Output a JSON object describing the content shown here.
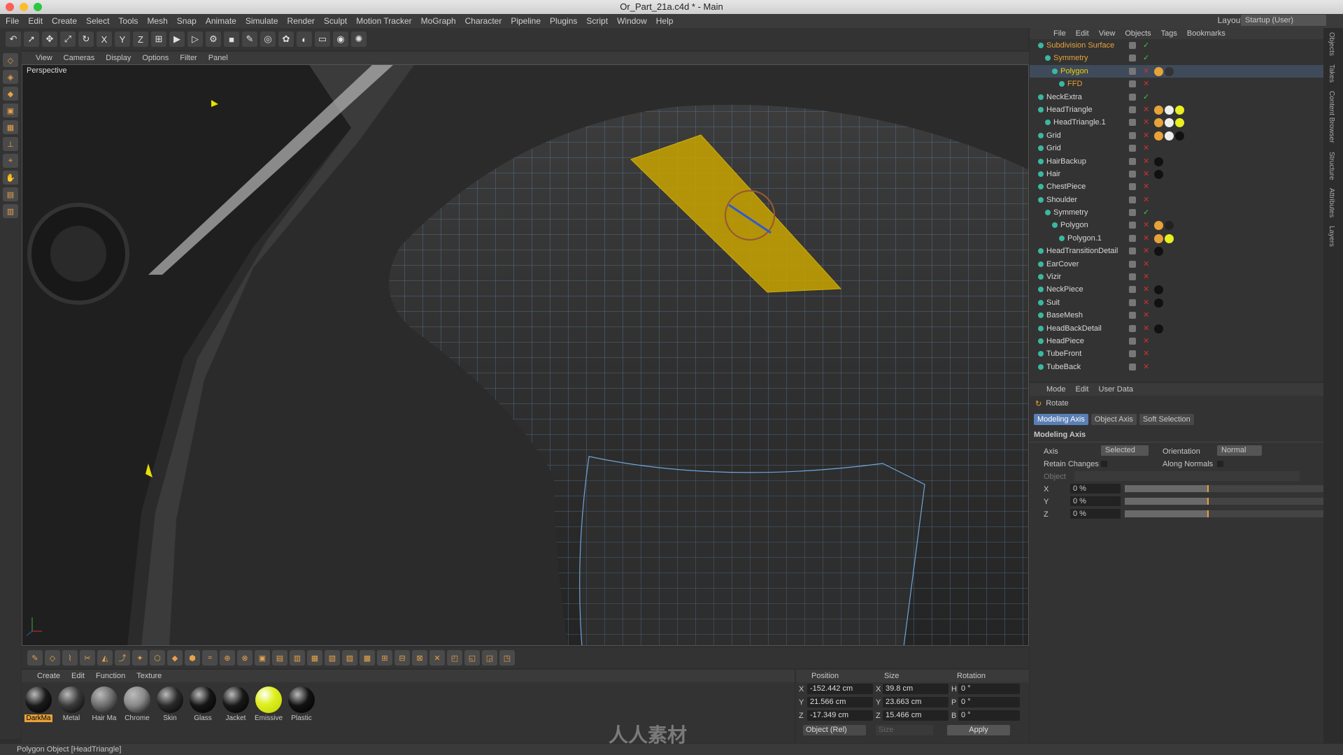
{
  "window": {
    "title": "Or_Part_21a.c4d * - Main"
  },
  "menu": [
    "File",
    "Edit",
    "Create",
    "Select",
    "Tools",
    "Mesh",
    "Snap",
    "Animate",
    "Simulate",
    "Render",
    "Sculpt",
    "Motion Tracker",
    "MoGraph",
    "Character",
    "Pipeline",
    "Plugins",
    "Script",
    "Window",
    "Help"
  ],
  "layout": {
    "label": "Layout:",
    "value": "Startup (User)"
  },
  "toolbar": {
    "icons": [
      "undo-icon",
      "select-icon",
      "move-icon",
      "scale-icon",
      "rotate-icon",
      "x-axis-icon",
      "y-axis-icon",
      "z-axis-icon",
      "coord-icon",
      "render-icon",
      "render-view-icon",
      "render-settings-icon",
      "cube-icon",
      "pen-icon",
      "subdivide-icon",
      "cloner-icon",
      "deformer-icon",
      "floor-icon",
      "camera-icon",
      "light-icon"
    ]
  },
  "viewport": {
    "menu": [
      "View",
      "Cameras",
      "Display",
      "Options",
      "Filter",
      "Panel"
    ],
    "label": "Perspective"
  },
  "objects": {
    "menu": [
      "File",
      "Edit",
      "View",
      "Objects",
      "Tags",
      "Bookmarks"
    ],
    "rows": [
      {
        "name": "Subdivision Surface",
        "indent": 0,
        "color": "#e8a23a",
        "check": "✓"
      },
      {
        "name": "Symmetry",
        "indent": 1,
        "color": "#e8a23a",
        "check": "✓"
      },
      {
        "name": "Polygon",
        "indent": 2,
        "color": "#f0d000",
        "check": "✕"
      },
      {
        "name": "FFD",
        "indent": 3,
        "color": "#e8a23a",
        "check": "✕"
      },
      {
        "name": "NeckExtra",
        "indent": 0,
        "color": "#d8d8d8",
        "check": "✓"
      },
      {
        "name": "HeadTriangle",
        "indent": 0,
        "color": "#d8d8d8",
        "check": "✕"
      },
      {
        "name": "HeadTriangle.1",
        "indent": 1,
        "color": "#d8d8d8",
        "check": "✕"
      },
      {
        "name": "Grid",
        "indent": 0,
        "color": "#d8d8d8",
        "check": "✕"
      },
      {
        "name": "Grid",
        "indent": 0,
        "color": "#d8d8d8",
        "check": "✕"
      },
      {
        "name": "HairBackup",
        "indent": 0,
        "color": "#d8d8d8",
        "check": "✕"
      },
      {
        "name": "Hair",
        "indent": 0,
        "color": "#d8d8d8",
        "check": "✕"
      },
      {
        "name": "ChestPiece",
        "indent": 0,
        "color": "#d8d8d8",
        "check": "✕"
      },
      {
        "name": "Shoulder",
        "indent": 0,
        "color": "#d8d8d8",
        "check": "✕"
      },
      {
        "name": "Symmetry",
        "indent": 1,
        "color": "#d8d8d8",
        "check": "✓"
      },
      {
        "name": "Polygon",
        "indent": 2,
        "color": "#d8d8d8",
        "check": "✕"
      },
      {
        "name": "Polygon.1",
        "indent": 3,
        "color": "#d8d8d8",
        "check": "✕"
      },
      {
        "name": "HeadTransitionDetail",
        "indent": 0,
        "color": "#d8d8d8",
        "check": "✕"
      },
      {
        "name": "EarCover",
        "indent": 0,
        "color": "#d8d8d8",
        "check": "✕"
      },
      {
        "name": "Vizir",
        "indent": 0,
        "color": "#d8d8d8",
        "check": "✕"
      },
      {
        "name": "NeckPiece",
        "indent": 0,
        "color": "#d8d8d8",
        "check": "✕"
      },
      {
        "name": "Suit",
        "indent": 0,
        "color": "#d8d8d8",
        "check": "✕"
      },
      {
        "name": "BaseMesh",
        "indent": 0,
        "color": "#d8d8d8",
        "check": "✕"
      },
      {
        "name": "HeadBackDetail",
        "indent": 0,
        "color": "#d8d8d8",
        "check": "✕"
      },
      {
        "name": "HeadPiece",
        "indent": 0,
        "color": "#d8d8d8",
        "check": "✕"
      },
      {
        "name": "TubeFront",
        "indent": 0,
        "color": "#d8d8d8",
        "check": "✕"
      },
      {
        "name": "TubeBack",
        "indent": 0,
        "color": "#d8d8d8",
        "check": "✕"
      }
    ]
  },
  "attributes": {
    "menu": [
      "Mode",
      "Edit",
      "User Data"
    ],
    "tool": "Rotate",
    "tabs": [
      "Modeling Axis",
      "Object Axis",
      "Soft Selection"
    ],
    "section": "Modeling Axis",
    "axis_label": "Axis",
    "axis_value": "Selected",
    "orientation_label": "Orientation",
    "orientation_value": "Normal",
    "retain_label": "Retain Changes",
    "normals_label": "Along Normals",
    "object_label": "Object",
    "x_label": "X",
    "x_value": "0 %",
    "y_label": "Y",
    "y_value": "0 %",
    "z_label": "Z",
    "z_value": "0 %"
  },
  "materials": {
    "menu": [
      "Create",
      "Edit",
      "Function",
      "Texture"
    ],
    "items": [
      {
        "name": "DarkMa",
        "color": "#1a1a1a"
      },
      {
        "name": "Metal",
        "color": "#3a3a3a"
      },
      {
        "name": "Hair Ma",
        "color": "#6e6e6e"
      },
      {
        "name": "Chrome",
        "color": "#888888"
      },
      {
        "name": "Skin",
        "color": "#2a2a2a"
      },
      {
        "name": "Glass",
        "color": "#151515"
      },
      {
        "name": "Jacket",
        "color": "#181818"
      },
      {
        "name": "Emissive",
        "color": "#dff020"
      },
      {
        "name": "Plastic",
        "color": "#121212"
      }
    ]
  },
  "coords": {
    "heads": [
      "Position",
      "Size",
      "Rotation"
    ],
    "rows": [
      {
        "a": "X",
        "pos": "-152.442 cm",
        "b": "X",
        "size": "39.8 cm",
        "c": "H",
        "rot": "0 °"
      },
      {
        "a": "Y",
        "pos": "21.566 cm",
        "b": "Y",
        "size": "23.663 cm",
        "c": "P",
        "rot": "0 °"
      },
      {
        "a": "Z",
        "pos": "-17.349 cm",
        "b": "Z",
        "size": "15.466 cm",
        "c": "B",
        "rot": "0 °"
      }
    ],
    "mode": "Object (Rel)",
    "size_mode": "Size",
    "apply": "Apply"
  },
  "status": "Polygon Object [HeadTriangle]",
  "watermark": "人人素材",
  "side_tabs": [
    "Objects",
    "Takes",
    "Content Browser",
    "Structure",
    "Attributes",
    "Layers"
  ]
}
